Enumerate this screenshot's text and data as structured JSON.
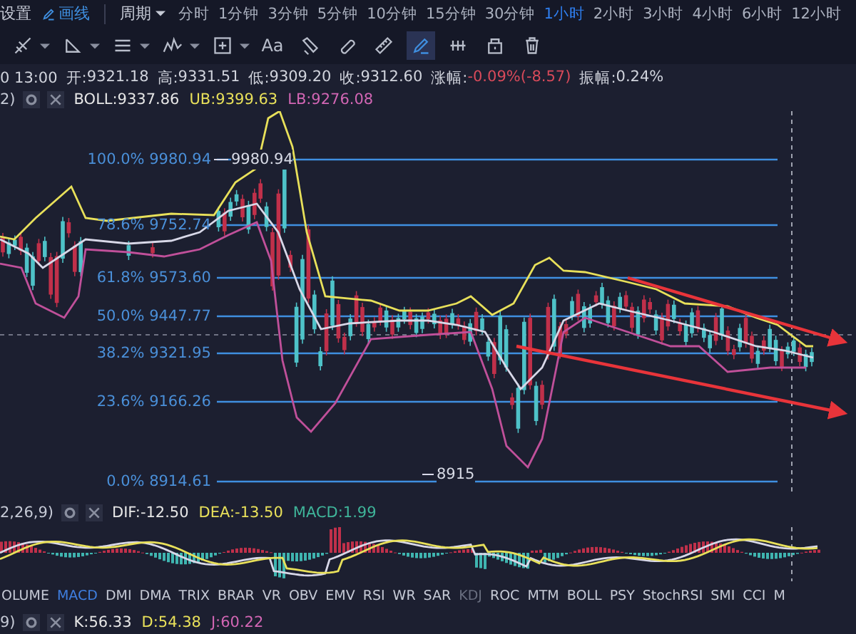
{
  "top_bar": {
    "settings_label": "设置",
    "draw_label": "画线",
    "period_label": "周期",
    "periods": [
      {
        "label": "分时",
        "selected": false
      },
      {
        "label": "1分钟",
        "selected": false
      },
      {
        "label": "3分钟",
        "selected": false
      },
      {
        "label": "5分钟",
        "selected": false
      },
      {
        "label": "10分钟",
        "selected": false
      },
      {
        "label": "15分钟",
        "selected": false
      },
      {
        "label": "30分钟",
        "selected": false
      },
      {
        "label": "1小时",
        "selected": true
      },
      {
        "label": "2小时",
        "selected": false
      },
      {
        "label": "3小时",
        "selected": false
      },
      {
        "label": "4小时",
        "selected": false
      },
      {
        "label": "6小时",
        "selected": false
      },
      {
        "label": "12小时",
        "selected": false
      }
    ]
  },
  "toolbar": {
    "tools": [
      {
        "kind": "crossline",
        "dropdown": true,
        "selected": false
      },
      {
        "kind": "angle",
        "dropdown": true,
        "selected": false
      },
      {
        "kind": "lines",
        "dropdown": true,
        "selected": false
      },
      {
        "kind": "peaks",
        "dropdown": true,
        "selected": false
      },
      {
        "kind": "frame",
        "dropdown": true,
        "selected": false
      },
      {
        "kind": "text",
        "label": "Aa",
        "dropdown": false,
        "selected": false
      },
      {
        "kind": "eraser",
        "dropdown": false,
        "selected": false
      },
      {
        "kind": "link",
        "dropdown": false,
        "selected": false
      },
      {
        "kind": "ruler",
        "dropdown": false,
        "selected": false
      },
      {
        "kind": "pen",
        "dropdown": false,
        "selected": true
      },
      {
        "kind": "fork",
        "dropdown": false,
        "selected": false
      },
      {
        "kind": "lock",
        "dropdown": false,
        "selected": false
      },
      {
        "kind": "trash",
        "dropdown": false,
        "selected": false
      }
    ]
  },
  "quote": {
    "time": "0 13:00",
    "items": [
      {
        "label": "开:",
        "value": "9321.18",
        "color": "#d0d3dc"
      },
      {
        "label": "高:",
        "value": "9331.51",
        "color": "#d0d3dc"
      },
      {
        "label": "低:",
        "value": "9309.20",
        "color": "#d0d3dc"
      },
      {
        "label": "收:",
        "value": "9312.60",
        "color": "#d0d3dc"
      },
      {
        "label": "涨幅:",
        "value": "-0.09%(-8.57)",
        "color": "#d84a5a"
      },
      {
        "label": "振幅:",
        "value": "0.24%",
        "color": "#d0d3dc"
      }
    ]
  },
  "boll": {
    "params": "2)",
    "values": [
      {
        "text": "BOLL:9337.86",
        "color": "#e6e6e6"
      },
      {
        "text": "UB:9399.63",
        "color": "#e8e05a"
      },
      {
        "text": "LB:9276.08",
        "color": "#d266b4"
      }
    ]
  },
  "fib_levels": [
    {
      "label": "100.0% 9980.94"
    },
    {
      "label": "78.6% 9752.74"
    },
    {
      "label": "61.8% 9573.60"
    },
    {
      "label": "50.0% 9447.77"
    },
    {
      "label": "38.2% 9321.95"
    },
    {
      "label": "23.6% 9166.26"
    },
    {
      "label": "0.0% 8914.61"
    }
  ],
  "high_marker": "9980.94",
  "low_marker": "8915",
  "macd": {
    "params": "2,26,9)",
    "values": [
      {
        "text": "DIF:-12.50",
        "color": "#e6e6e6"
      },
      {
        "text": "DEA:-13.50",
        "color": "#e8e05a"
      },
      {
        "text": "MACD:1.99",
        "color": "#3fb59a"
      }
    ]
  },
  "indicator_tabs": [
    {
      "label": "OLUME",
      "selected": false,
      "dimmed": false
    },
    {
      "label": "MACD",
      "selected": true,
      "dimmed": false
    },
    {
      "label": "DMI",
      "selected": false,
      "dimmed": false
    },
    {
      "label": "DMA",
      "selected": false,
      "dimmed": false
    },
    {
      "label": "TRIX",
      "selected": false,
      "dimmed": false
    },
    {
      "label": "BRAR",
      "selected": false,
      "dimmed": false
    },
    {
      "label": "VR",
      "selected": false,
      "dimmed": false
    },
    {
      "label": "OBV",
      "selected": false,
      "dimmed": false
    },
    {
      "label": "EMV",
      "selected": false,
      "dimmed": false
    },
    {
      "label": "RSI",
      "selected": false,
      "dimmed": false
    },
    {
      "label": "WR",
      "selected": false,
      "dimmed": false
    },
    {
      "label": "SAR",
      "selected": false,
      "dimmed": false
    },
    {
      "label": "KDJ",
      "selected": false,
      "dimmed": true
    },
    {
      "label": "ROC",
      "selected": false,
      "dimmed": false
    },
    {
      "label": "MTM",
      "selected": false,
      "dimmed": false
    },
    {
      "label": "BOLL",
      "selected": false,
      "dimmed": false
    },
    {
      "label": "PSY",
      "selected": false,
      "dimmed": false
    },
    {
      "label": "StochRSI",
      "selected": false,
      "dimmed": false
    },
    {
      "label": "SMI",
      "selected": false,
      "dimmed": false
    },
    {
      "label": "CCI",
      "selected": false,
      "dimmed": false
    },
    {
      "label": "M",
      "selected": false,
      "dimmed": false
    }
  ],
  "kdj": {
    "params": "9)",
    "values": [
      {
        "text": "K:56.33",
        "color": "#e6e6e6"
      },
      {
        "text": "D:54.38",
        "color": "#e8e05a"
      },
      {
        "text": "J:60.22",
        "color": "#d266b4"
      }
    ]
  }
}
